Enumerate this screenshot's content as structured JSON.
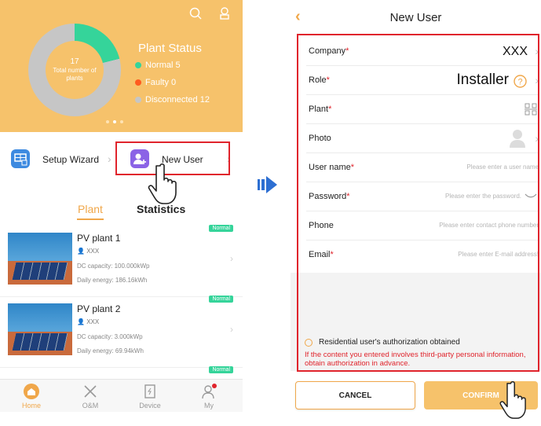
{
  "left": {
    "status": {
      "title": "Plant Status",
      "total_number": "17",
      "total_label": "Total number of plants",
      "normal": "Normal 5",
      "faulty": "Faulty 0",
      "disconnected": "Disconnected 12",
      "colors": {
        "normal": "#35d49a",
        "faulty": "#ff5a1f",
        "disconnected": "#c6c6c6"
      }
    },
    "quick": {
      "setup_wizard": "Setup Wizard",
      "new_user": "New User"
    },
    "tabs": {
      "plant": "Plant",
      "statistics": "Statistics"
    },
    "plants": [
      {
        "name": "PV plant 1",
        "company": "XXX",
        "capacity": "DC capacity: 100.000kWp",
        "energy": "Daily energy: 186.16kWh",
        "badge": "Normal"
      },
      {
        "name": "PV plant 2",
        "company": "XXX",
        "capacity": "DC capacity: 3.000kWp",
        "energy": "Daily energy: 69.94kWh",
        "badge": "Normal"
      },
      {
        "badge": "Normal"
      }
    ],
    "nav": {
      "home": "Home",
      "om": "O&M",
      "device": "Device",
      "my": "My"
    },
    "accent": "#f0a74a"
  },
  "right": {
    "title": "New User",
    "fields": {
      "company": {
        "label": "Company",
        "value": "XXX"
      },
      "role": {
        "label": "Role",
        "value": "Installer"
      },
      "plant": {
        "label": "Plant"
      },
      "photo": {
        "label": "Photo"
      },
      "username": {
        "label": "User name",
        "placeholder": "Please enter a user name"
      },
      "password": {
        "label": "Password",
        "placeholder": "Please enter the password."
      },
      "phone": {
        "label": "Phone",
        "placeholder": "Please enter contact phone number"
      },
      "email": {
        "label": "Email",
        "placeholder": "Please enter E-mail address!"
      }
    },
    "required_mark": "*",
    "auth": "Residential user's authorization obtained",
    "warning": "If the content you entered involves third-party personal information, obtain authorization in advance.",
    "cancel": "CANCEL",
    "confirm": "CONFIRM"
  }
}
